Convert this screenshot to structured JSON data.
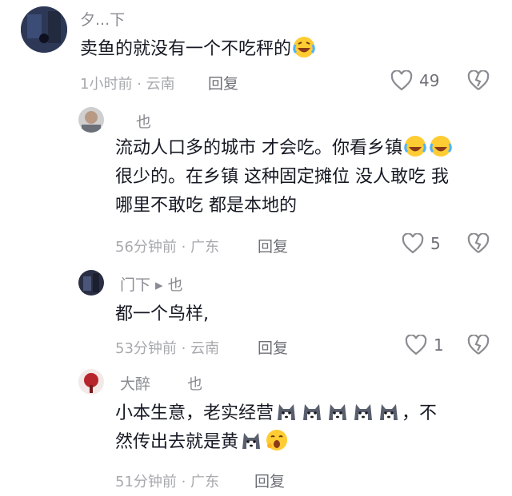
{
  "comments": [
    {
      "username": "夕...下",
      "text": "卖鱼的就没有一个不吃秤的",
      "emojis": [
        "laugh-cry-emoji"
      ],
      "time": "1小时前",
      "location": "云南",
      "reply_label": "回复",
      "likes": "49"
    },
    {
      "username": "也",
      "text_lines": [
        "流动人口多的城市 才会吃。你看乡镇",
        "很少的。在乡镇 这种固定摊位 没人敢吃 我",
        "哪里不敢吃 都是本地的"
      ],
      "time": "56分钟前",
      "location": "广东",
      "reply_label": "回复",
      "likes": "5"
    },
    {
      "username": "门下 ▸ 也",
      "text": "都一个鸟样,",
      "time": "53分钟前",
      "location": "云南",
      "reply_label": "回复",
      "likes": "1"
    },
    {
      "username": "大醉",
      "username2": "也",
      "text_part1": "小本生意，老实经营",
      "text_part2": "，不",
      "text_line2": "然传出去就是黄",
      "time": "51分钟前",
      "location": "广东",
      "reply_label": "回复"
    }
  ],
  "separator": "·",
  "colors": {
    "text": "#161823",
    "meta": "#a8a9ae",
    "icon": "#8a8b91"
  }
}
